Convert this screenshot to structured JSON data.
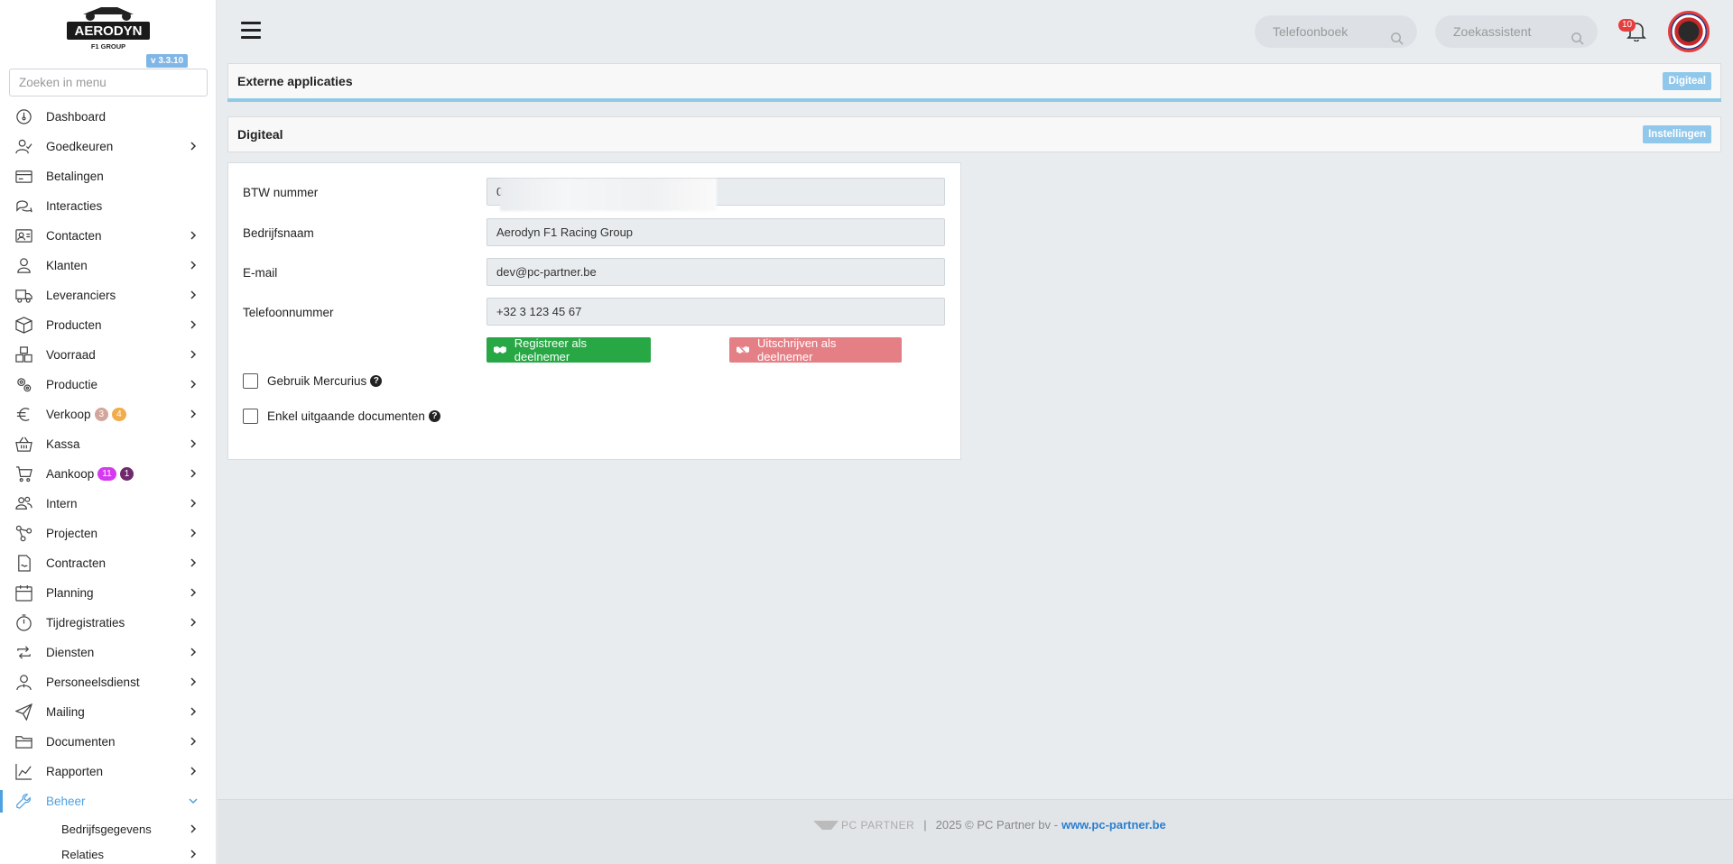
{
  "app": {
    "logo_text": "AERODYN",
    "logo_sub": "F1 GROUP",
    "version": "v 3.3.10"
  },
  "sidebar": {
    "search_placeholder": "Zoeken in menu",
    "items": [
      {
        "label": "Dashboard",
        "icon": "dashboard-icon",
        "chevron": false
      },
      {
        "label": "Goedkeuren",
        "icon": "user-check-icon",
        "chevron": true
      },
      {
        "label": "Betalingen",
        "icon": "credit-card-icon",
        "chevron": false
      },
      {
        "label": "Interacties",
        "icon": "chat-icon",
        "chevron": false
      },
      {
        "label": "Contacten",
        "icon": "contact-card-icon",
        "chevron": true
      },
      {
        "label": "Klanten",
        "icon": "user-icon",
        "chevron": true
      },
      {
        "label": "Leveranciers",
        "icon": "truck-icon",
        "chevron": true
      },
      {
        "label": "Producten",
        "icon": "box-icon",
        "chevron": true
      },
      {
        "label": "Voorraad",
        "icon": "boxes-icon",
        "chevron": true
      },
      {
        "label": "Productie",
        "icon": "gears-icon",
        "chevron": true
      },
      {
        "label": "Verkoop",
        "icon": "euro-icon",
        "chevron": true,
        "badges": [
          {
            "text": "3",
            "color": "#d4a59a"
          },
          {
            "text": "4",
            "color": "#f0ad4e"
          }
        ]
      },
      {
        "label": "Kassa",
        "icon": "basket-icon",
        "chevron": true
      },
      {
        "label": "Aankoop",
        "icon": "cart-icon",
        "chevron": true,
        "badges": [
          {
            "text": "11",
            "color": "#d63af0"
          },
          {
            "text": "1",
            "color": "#6f2a6e"
          }
        ]
      },
      {
        "label": "Intern",
        "icon": "users-icon",
        "chevron": true
      },
      {
        "label": "Projecten",
        "icon": "project-icon",
        "chevron": true
      },
      {
        "label": "Contracten",
        "icon": "contract-icon",
        "chevron": true
      },
      {
        "label": "Planning",
        "icon": "calendar-icon",
        "chevron": true
      },
      {
        "label": "Tijdregistraties",
        "icon": "timer-icon",
        "chevron": true
      },
      {
        "label": "Diensten",
        "icon": "repeat-icon",
        "chevron": true
      },
      {
        "label": "Personeelsdienst",
        "icon": "staff-icon",
        "chevron": true
      },
      {
        "label": "Mailing",
        "icon": "paper-plane-icon",
        "chevron": true
      },
      {
        "label": "Documenten",
        "icon": "folder-icon",
        "chevron": true
      },
      {
        "label": "Rapporten",
        "icon": "chart-line-icon",
        "chevron": true
      },
      {
        "label": "Beheer",
        "icon": "wrench-icon",
        "chevron": true,
        "active": true
      }
    ],
    "subitems": [
      {
        "label": "Bedrijfsgegevens"
      },
      {
        "label": "Relaties"
      }
    ]
  },
  "topbar": {
    "phonebook_placeholder": "Telefoonboek",
    "assistant_placeholder": "Zoekassistent",
    "notification_count": "10"
  },
  "page": {
    "header_title": "Externe applicaties",
    "header_tag": "Digiteal",
    "section_title": "Digiteal",
    "section_button": "Instellingen"
  },
  "form": {
    "fields": [
      {
        "label": "BTW nummer",
        "value": "0"
      },
      {
        "label": "Bedrijfsnaam",
        "value": "Aerodyn F1 Racing Group"
      },
      {
        "label": "E-mail",
        "value": "dev@pc-partner.be"
      },
      {
        "label": "Telefoonnummer",
        "value": "+32 3 123 45 67"
      }
    ],
    "register_button": "Registreer als deelnemer",
    "unregister_button": "Uitschrijven als deelnemer",
    "register_color": "#28a745",
    "unregister_color": "#e57f86",
    "checkbox_mercurius": "Gebruik Mercurius",
    "checkbox_outgoing": "Enkel uitgaande documenten"
  },
  "footer": {
    "logo_text": "PC PARTNER",
    "separator": "|",
    "copyright": "2025 © PC Partner bv - ",
    "link": "www.pc-partner.be"
  }
}
